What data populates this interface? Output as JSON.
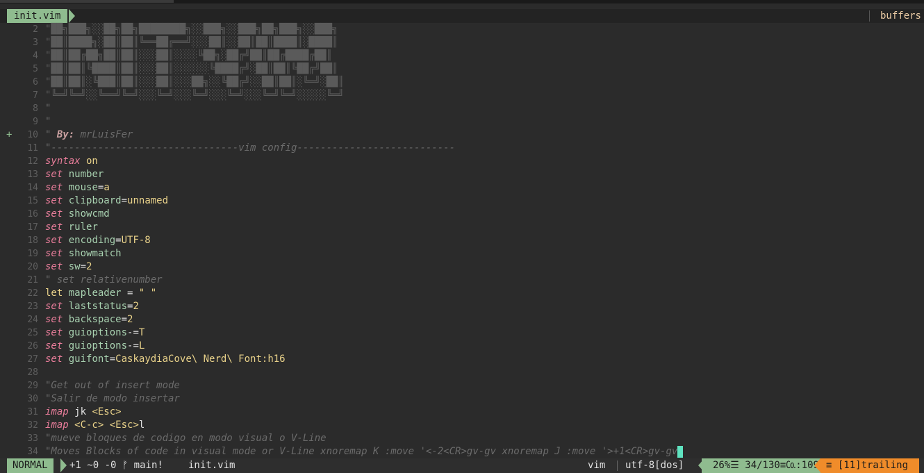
{
  "tabline": {
    "active_tab": "init.vim",
    "buffers_label": "buffers"
  },
  "editor": {
    "lines": [
      {
        "n": "2",
        "sign": "",
        "parts": [
          {
            "c": "c-art",
            "t": "\"██╗███╗░░██╗██╗████████╗░░███╗░░███╗██╗███╗░░███╗"
          }
        ]
      },
      {
        "n": "3",
        "sign": "",
        "parts": [
          {
            "c": "c-art",
            "t": "\"██║████╗░██║██║╚══██╔══╝░░░██║░░██║██║████║░████║"
          }
        ]
      },
      {
        "n": "4",
        "sign": "",
        "parts": [
          {
            "c": "c-art",
            "t": "\"██║██╔██╗██║██║░░░██║░░░░╚██╗░██╔╝██║██╔████╔██║"
          }
        ]
      },
      {
        "n": "5",
        "sign": "",
        "parts": [
          {
            "c": "c-art",
            "t": "\"██║██║╚████║██║░░░██║░░░░░░╚████╔╝░██║██║╚██╔╝██║"
          }
        ]
      },
      {
        "n": "6",
        "sign": "",
        "parts": [
          {
            "c": "c-art",
            "t": "\"██║██║░╚███║██║░░░██║░░░██╗░░╚██╔╝░░██║██║░╚═╝░██║"
          }
        ]
      },
      {
        "n": "7",
        "sign": "",
        "parts": [
          {
            "c": "c-art",
            "t": "\"╚═╝╚═╝░░╚══╝╚═╝░░░╚═╝░░░╚═╝░░░╚═╝░░░╚═╝╚═╝░░░░░╚═╝"
          }
        ]
      },
      {
        "n": "8",
        "sign": "",
        "parts": [
          {
            "c": "c-com",
            "t": "\""
          }
        ]
      },
      {
        "n": "9",
        "sign": "",
        "parts": [
          {
            "c": "c-com",
            "t": "\""
          }
        ]
      },
      {
        "n": "10",
        "sign": "+",
        "parts": [
          {
            "c": "c-com",
            "t": "\" "
          },
          {
            "c": "c-by",
            "t": "By:"
          },
          {
            "c": "c-com",
            "t": " mrLuisFer"
          }
        ]
      },
      {
        "n": "11",
        "sign": "",
        "parts": [
          {
            "c": "c-com",
            "t": "\"--------------------------------vim config---------------------------"
          }
        ]
      },
      {
        "n": "12",
        "sign": "",
        "parts": [
          {
            "c": "c-kw",
            "t": "syntax"
          },
          {
            "c": "c-val",
            "t": " on"
          }
        ]
      },
      {
        "n": "13",
        "sign": "",
        "parts": [
          {
            "c": "c-kw",
            "t": "set"
          },
          {
            "c": "c-opt",
            "t": " number"
          }
        ]
      },
      {
        "n": "14",
        "sign": "",
        "parts": [
          {
            "c": "c-kw",
            "t": "set"
          },
          {
            "c": "c-opt",
            "t": " mouse"
          },
          {
            "c": "c-plain",
            "t": "="
          },
          {
            "c": "c-val",
            "t": "a"
          }
        ]
      },
      {
        "n": "15",
        "sign": "",
        "parts": [
          {
            "c": "c-kw",
            "t": "set"
          },
          {
            "c": "c-opt",
            "t": " clipboard"
          },
          {
            "c": "c-plain",
            "t": "="
          },
          {
            "c": "c-val",
            "t": "unnamed"
          }
        ]
      },
      {
        "n": "16",
        "sign": "",
        "parts": [
          {
            "c": "c-kw",
            "t": "set"
          },
          {
            "c": "c-opt",
            "t": " showcmd"
          }
        ]
      },
      {
        "n": "17",
        "sign": "",
        "parts": [
          {
            "c": "c-kw",
            "t": "set"
          },
          {
            "c": "c-opt",
            "t": " ruler"
          }
        ]
      },
      {
        "n": "18",
        "sign": "",
        "parts": [
          {
            "c": "c-kw",
            "t": "set"
          },
          {
            "c": "c-opt",
            "t": " encoding"
          },
          {
            "c": "c-plain",
            "t": "="
          },
          {
            "c": "c-val",
            "t": "UTF-8"
          }
        ]
      },
      {
        "n": "19",
        "sign": "",
        "parts": [
          {
            "c": "c-kw",
            "t": "set"
          },
          {
            "c": "c-opt",
            "t": " showmatch"
          }
        ]
      },
      {
        "n": "20",
        "sign": "",
        "parts": [
          {
            "c": "c-kw",
            "t": "set"
          },
          {
            "c": "c-opt",
            "t": " sw"
          },
          {
            "c": "c-plain",
            "t": "="
          },
          {
            "c": "c-val",
            "t": "2"
          }
        ]
      },
      {
        "n": "21",
        "sign": "",
        "parts": [
          {
            "c": "c-com",
            "t": "\" set relativenumber"
          }
        ]
      },
      {
        "n": "22",
        "sign": "",
        "parts": [
          {
            "c": "c-val",
            "t": "let"
          },
          {
            "c": "c-opt",
            "t": " mapleader"
          },
          {
            "c": "c-plain",
            "t": " = "
          },
          {
            "c": "c-str",
            "t": "\" \""
          }
        ]
      },
      {
        "n": "23",
        "sign": "",
        "parts": [
          {
            "c": "c-kw",
            "t": "set"
          },
          {
            "c": "c-opt",
            "t": " laststatus"
          },
          {
            "c": "c-plain",
            "t": "="
          },
          {
            "c": "c-val",
            "t": "2"
          }
        ]
      },
      {
        "n": "24",
        "sign": "",
        "parts": [
          {
            "c": "c-kw",
            "t": "set"
          },
          {
            "c": "c-opt",
            "t": " backspace"
          },
          {
            "c": "c-plain",
            "t": "="
          },
          {
            "c": "c-val",
            "t": "2"
          }
        ]
      },
      {
        "n": "25",
        "sign": "",
        "parts": [
          {
            "c": "c-kw",
            "t": "set"
          },
          {
            "c": "c-opt",
            "t": " guioptions"
          },
          {
            "c": "c-plain",
            "t": "-="
          },
          {
            "c": "c-val",
            "t": "T"
          }
        ]
      },
      {
        "n": "26",
        "sign": "",
        "parts": [
          {
            "c": "c-kw",
            "t": "set"
          },
          {
            "c": "c-opt",
            "t": " guioptions"
          },
          {
            "c": "c-plain",
            "t": "-="
          },
          {
            "c": "c-val",
            "t": "L"
          }
        ]
      },
      {
        "n": "27",
        "sign": "",
        "parts": [
          {
            "c": "c-kw",
            "t": "set"
          },
          {
            "c": "c-opt",
            "t": " guifont"
          },
          {
            "c": "c-plain",
            "t": "="
          },
          {
            "c": "c-val",
            "t": "CaskaydiaCove\\ Nerd\\ Font:h16"
          }
        ]
      },
      {
        "n": "28",
        "sign": "",
        "parts": []
      },
      {
        "n": "29",
        "sign": "",
        "parts": [
          {
            "c": "c-com",
            "t": "\"Get out of insert mode"
          }
        ]
      },
      {
        "n": "30",
        "sign": "",
        "parts": [
          {
            "c": "c-com",
            "t": "\"Salir de modo insertar"
          }
        ]
      },
      {
        "n": "31",
        "sign": "",
        "parts": [
          {
            "c": "c-kw",
            "t": "imap"
          },
          {
            "c": "c-key",
            "t": " jk "
          },
          {
            "c": "c-val",
            "t": "<Esc>"
          }
        ]
      },
      {
        "n": "32",
        "sign": "",
        "parts": [
          {
            "c": "c-kw",
            "t": "imap"
          },
          {
            "c": "c-val",
            "t": " <C-c>"
          },
          {
            "c": "c-key",
            "t": " "
          },
          {
            "c": "c-val",
            "t": "<Esc>"
          },
          {
            "c": "c-key",
            "t": "l"
          }
        ]
      },
      {
        "n": "33",
        "sign": "",
        "parts": [
          {
            "c": "c-com",
            "t": "\"mueve bloques de codigo en modo visual o V-Line"
          }
        ]
      },
      {
        "n": "34",
        "sign": "",
        "parts": [
          {
            "c": "c-com",
            "t": "\"Moves Blocks of code in visual mode or V-Line xnoremap K :move '<-2<CR>gv-gv xnoremap J :move '>+1<CR>gv-gv"
          }
        ],
        "cursor": true
      }
    ]
  },
  "statusline": {
    "mode": "NORMAL",
    "git": "+1 ~0 -0 ᚠ main!",
    "file": "init.vim",
    "filetype": "vim",
    "encoding": "utf-8[dos]",
    "position": "26%☰ 34/130≡㏇:109",
    "warning": "≡ [11]trailing"
  },
  "colors": {
    "accent": "#8fbc8f",
    "warning": "#f08c2a",
    "background": "#2b2b2b",
    "cursor": "#5fe3c0",
    "keyword": "#e87d9a"
  }
}
